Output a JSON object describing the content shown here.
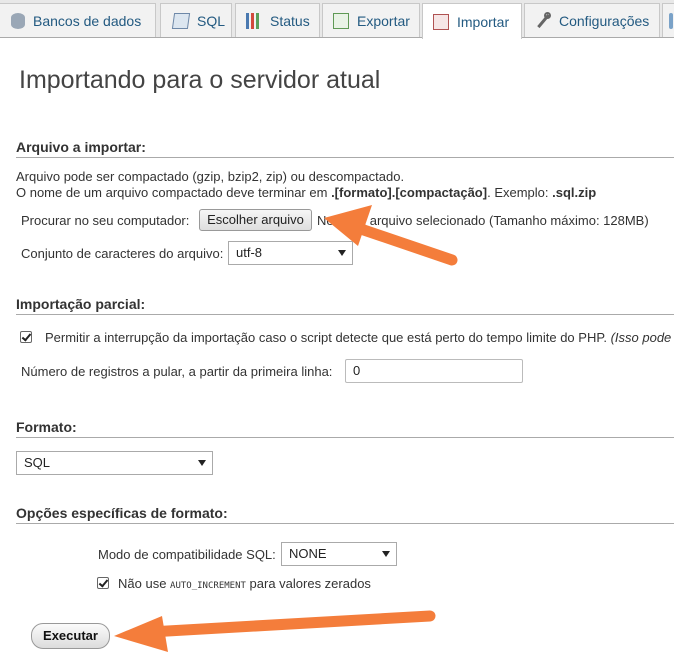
{
  "tabs": [
    {
      "label": "Bancos de dados",
      "icon": "database-icon"
    },
    {
      "label": "SQL",
      "icon": "sql-icon"
    },
    {
      "label": "Status",
      "icon": "status-chart-icon"
    },
    {
      "label": "Exportar",
      "icon": "export-icon"
    },
    {
      "label": "Importar",
      "icon": "import-icon",
      "active": true
    },
    {
      "label": "Configurações",
      "icon": "wrench-icon"
    },
    {
      "label": "",
      "icon": "more-icon"
    }
  ],
  "page_title": "Importando para o servidor atual",
  "file_section": {
    "heading": "Arquivo a importar:",
    "note_line1": "Arquivo pode ser compactado (gzip, bzip2, zip) ou descompactado.",
    "note_line2_prefix": "O nome de um arquivo compactado deve terminar em",
    "note_line2_format": ".[formato].[compactação]",
    "note_line2_example": ". Exemplo:",
    "note_line2_ext": ".sql.zip",
    "browse_label": "Procurar no seu computador:",
    "choose_file_button": "Escolher arquivo",
    "no_file_text": "Nenhum arquivo selecionado",
    "max_size": "(Tamanho máximo: 128MB)",
    "charset_label": "Conjunto de caracteres do arquivo:",
    "charset_value": "utf-8"
  },
  "partial_section": {
    "heading": "Importação parcial:",
    "allow_interrupt_label": "Permitir a interrupção da importação caso o script detecte que está perto do tempo limite do PHP.",
    "allow_interrupt_note": "(Isso pode",
    "allow_interrupt_checked": true,
    "skip_label": "Número de registros a pular, a partir da primeira linha:",
    "skip_value": "0"
  },
  "format_section": {
    "heading": "Formato:",
    "format_value": "SQL"
  },
  "options_section": {
    "heading": "Opções específicas de formato:",
    "compat_label": "Modo de compatibilidade SQL:",
    "compat_value": "NONE",
    "no_auto_prefix": "Não use",
    "no_auto_code": "AUTO_INCREMENT",
    "no_auto_suffix": "para valores zerados",
    "no_auto_checked": true
  },
  "execute_button": "Executar",
  "colors": {
    "link": "#235a81",
    "annotation_arrow": "#f47d3b"
  }
}
